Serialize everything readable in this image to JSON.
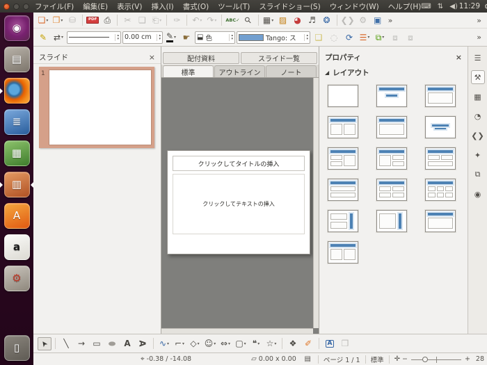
{
  "topbar": {
    "window_controls": [
      {
        "name": "close-button"
      },
      {
        "name": "minimize-button"
      },
      {
        "name": "maximize-button"
      }
    ],
    "menus": [
      {
        "name": "menu-file",
        "label": "ファイル(F)"
      },
      {
        "name": "menu-edit",
        "label": "編集(E)"
      },
      {
        "name": "menu-view",
        "label": "表示(V)"
      },
      {
        "name": "menu-insert",
        "label": "挿入(I)"
      },
      {
        "name": "menu-format",
        "label": "書式(O)"
      },
      {
        "name": "menu-tools",
        "label": "ツール(T)"
      },
      {
        "name": "menu-slideshow",
        "label": "スライドショー(S)"
      },
      {
        "name": "menu-window",
        "label": "ウィンドウ(W)"
      },
      {
        "name": "menu-help",
        "label": "ヘルプ(H)"
      }
    ],
    "tray": [
      {
        "name": "keyboard-indicator-icon",
        "glyph": "⌨"
      },
      {
        "name": "network-indicator-icon",
        "glyph": "⇅"
      },
      {
        "name": "volume-indicator-icon",
        "glyph": "◀)"
      }
    ],
    "clock": "11:29",
    "session_glyph": "⚙"
  },
  "launcher": {
    "items": [
      {
        "name": "launcher-ubuntu-dash",
        "kind": "ubuntu",
        "glyph": "◉"
      },
      {
        "name": "launcher-files",
        "kind": "files",
        "glyph": "▤"
      },
      {
        "name": "launcher-firefox",
        "kind": "firefox",
        "glyph": "",
        "pips": [
          "left"
        ]
      },
      {
        "name": "launcher-writer",
        "kind": "writer",
        "glyph": "≣"
      },
      {
        "name": "launcher-calc",
        "kind": "calc",
        "glyph": "▦"
      },
      {
        "name": "launcher-impress",
        "kind": "impress",
        "glyph": "▥",
        "pips": [
          "left",
          "right"
        ]
      },
      {
        "name": "launcher-software-center",
        "kind": "software",
        "glyph": "A"
      },
      {
        "name": "launcher-amazon",
        "kind": "amazon",
        "glyph": "a"
      },
      {
        "name": "launcher-settings",
        "kind": "settings",
        "glyph": "⚙"
      },
      {
        "name": "launcher-trash",
        "kind": "trash",
        "glyph": "▯",
        "pin": "bottom"
      }
    ]
  },
  "toolbar_main": {
    "items": [
      {
        "t": "b",
        "name": "new-presentation-button",
        "glyph": "❏",
        "cls": "c-impress",
        "dd": true
      },
      {
        "t": "b",
        "name": "open-button",
        "glyph": "❐",
        "cls": "c-folder",
        "dd": true
      },
      {
        "t": "b",
        "name": "save-button",
        "glyph": "⛁",
        "dim": true
      },
      {
        "t": "s"
      },
      {
        "t": "b",
        "name": "export-pdf-button",
        "glyph": "PDF",
        "cls": "i-pdf"
      },
      {
        "t": "b",
        "name": "print-button",
        "glyph": "⎙"
      },
      {
        "t": "s"
      },
      {
        "t": "b",
        "name": "cut-button",
        "glyph": "✂",
        "dim": true
      },
      {
        "t": "b",
        "name": "copy-button",
        "glyph": "❏",
        "dim": true
      },
      {
        "t": "b",
        "name": "paste-button",
        "glyph": "⎗",
        "dim": true,
        "dd": true
      },
      {
        "t": "s"
      },
      {
        "t": "b",
        "name": "clone-formatting-button",
        "glyph": "✑",
        "dim": true
      },
      {
        "t": "s"
      },
      {
        "t": "b",
        "name": "undo-button",
        "glyph": "↶",
        "dim": true,
        "dd": true
      },
      {
        "t": "b",
        "name": "redo-button",
        "glyph": "↷",
        "dim": true,
        "dd": true
      },
      {
        "t": "s"
      },
      {
        "t": "b",
        "name": "spelling-button",
        "glyph": "ABC✓",
        "cls": "i-spell"
      },
      {
        "t": "b",
        "name": "zoom-button",
        "glyph": "⚲",
        "cls": "i-zoom"
      },
      {
        "t": "s"
      },
      {
        "t": "b",
        "name": "insert-table-button",
        "glyph": "▦",
        "cls": "c-table",
        "dd": true
      },
      {
        "t": "b",
        "name": "insert-image-button",
        "glyph": "▨",
        "cls": "c-image"
      },
      {
        "t": "b",
        "name": "insert-chart-button",
        "glyph": "◕",
        "cls": "c-chart"
      },
      {
        "t": "b",
        "name": "insert-media-button",
        "glyph": "♬",
        "cls": "c-media"
      },
      {
        "t": "b",
        "name": "insert-hyperlink-button",
        "glyph": "❂",
        "cls": "c-blue"
      },
      {
        "t": "s"
      },
      {
        "t": "b",
        "name": "show-draw-functions-button",
        "glyph": "❮❯",
        "dim": true
      },
      {
        "t": "b",
        "name": "options-button",
        "glyph": "⚙",
        "dim": true
      },
      {
        "t": "b",
        "name": "presentation-button",
        "glyph": "▣",
        "cls": "c-screen"
      },
      {
        "t": "o",
        "name": "standard-toolbar-overflow"
      },
      {
        "t": "sp"
      },
      {
        "t": "o",
        "name": "presentation-toolbar-overflow"
      }
    ]
  },
  "toolbar_line": {
    "items": [
      {
        "t": "b",
        "name": "line-button",
        "glyph": "✎",
        "cls": "c-pen"
      },
      {
        "t": "b",
        "name": "arrow-style-button",
        "glyph": "⇄",
        "dd": true
      },
      {
        "t": "c",
        "name": "line-style-select",
        "kind": "line",
        "spin": true,
        "w": 78
      },
      {
        "t": "c",
        "name": "line-width-spinner",
        "value": "0.00 cm",
        "spin": true,
        "w": 58
      },
      {
        "t": "b",
        "name": "line-color-button",
        "glyph": "✎",
        "cls": "u-black",
        "dd": true
      },
      {
        "t": "b",
        "name": "area-dialog-button",
        "glyph": "☛",
        "cls": "c-hand"
      },
      {
        "t": "c",
        "name": "area-style-select",
        "glyph": "⬓",
        "value": "色",
        "spin": true,
        "w": 58
      },
      {
        "t": "c",
        "name": "fill-color-select",
        "kind": "swatch",
        "value": "Tango: ス",
        "spin": true,
        "w": 106
      },
      {
        "t": "b",
        "name": "shadow-button",
        "glyph": "❑",
        "cls": "c-shadow"
      },
      {
        "t": "b",
        "name": "transform-button",
        "glyph": "◌",
        "dim": true
      },
      {
        "t": "b",
        "name": "rotate-button",
        "glyph": "⟳",
        "cls": "c-rotate"
      },
      {
        "t": "b",
        "name": "align-button",
        "glyph": "☰",
        "cls": "c-align",
        "dd": true
      },
      {
        "t": "b",
        "name": "arrange-button",
        "glyph": "⧉",
        "cls": "c-green",
        "dd": true
      },
      {
        "t": "b",
        "name": "group-button",
        "glyph": "⧈",
        "dim": true
      },
      {
        "t": "b",
        "name": "enter-group-button",
        "glyph": "⧈",
        "dim": true
      },
      {
        "t": "sp"
      },
      {
        "t": "o",
        "name": "line-toolbar-overflow"
      }
    ]
  },
  "slides_panel": {
    "title": "スライド",
    "close_glyph": "×",
    "slides": [
      {
        "number": "1"
      }
    ]
  },
  "workspace": {
    "tabs_upper": [
      {
        "name": "tab-handout",
        "label": "配付資料"
      },
      {
        "name": "tab-slide-sorter",
        "label": "スライド一覧"
      }
    ],
    "tabs_lower": [
      {
        "name": "tab-normal",
        "label": "標準",
        "active": true
      },
      {
        "name": "tab-outline",
        "label": "アウトライン"
      },
      {
        "name": "tab-notes",
        "label": "ノート"
      }
    ],
    "slide": {
      "title_placeholder": "クリックしてタイトルの挿入",
      "text_placeholder": "クリックしてテキストの挿入"
    }
  },
  "properties_panel": {
    "title": "プロパティ",
    "close_glyph": "×",
    "collapse_glyph": "◢",
    "section_label": "レイアウト",
    "layouts": [
      {
        "id": "blank",
        "boxes": []
      },
      {
        "id": "title-subtitle",
        "boxes": [
          [
            8,
            10,
            84,
            14,
            "bar"
          ],
          [
            30,
            42,
            40,
            12,
            "bar"
          ]
        ]
      },
      {
        "id": "title-content",
        "boxes": [
          [
            8,
            10,
            84,
            14,
            "bar"
          ],
          [
            8,
            32,
            84,
            56,
            "box"
          ]
        ]
      },
      {
        "id": "title-two-content",
        "boxes": [
          [
            8,
            10,
            84,
            14,
            "bar"
          ],
          [
            8,
            32,
            40,
            56,
            "box"
          ],
          [
            52,
            32,
            40,
            56,
            "box"
          ]
        ]
      },
      {
        "id": "title-only",
        "boxes": [
          [
            8,
            10,
            84,
            14,
            "bar"
          ],
          [
            8,
            32,
            84,
            56,
            "box"
          ]
        ]
      },
      {
        "id": "centered-text",
        "boxes": [
          [
            22,
            38,
            56,
            10,
            "bar"
          ],
          [
            30,
            52,
            40,
            8,
            "bar"
          ]
        ]
      },
      {
        "id": "two-content-and-content",
        "boxes": [
          [
            8,
            10,
            84,
            14,
            "bar"
          ],
          [
            8,
            32,
            40,
            25,
            "box"
          ],
          [
            8,
            62,
            40,
            26,
            "box"
          ],
          [
            52,
            32,
            40,
            56,
            "box"
          ]
        ]
      },
      {
        "id": "content-and-two-content",
        "boxes": [
          [
            8,
            10,
            84,
            14,
            "bar"
          ],
          [
            8,
            32,
            40,
            56,
            "box"
          ],
          [
            52,
            32,
            40,
            25,
            "box"
          ],
          [
            52,
            62,
            40,
            26,
            "box"
          ]
        ]
      },
      {
        "id": "two-content-over-content",
        "boxes": [
          [
            8,
            10,
            84,
            14,
            "bar"
          ],
          [
            8,
            32,
            40,
            25,
            "box"
          ],
          [
            52,
            32,
            40,
            25,
            "box"
          ],
          [
            8,
            62,
            84,
            26,
            "box"
          ]
        ]
      },
      {
        "id": "content-over-content",
        "boxes": [
          [
            8,
            10,
            84,
            14,
            "bar"
          ],
          [
            8,
            32,
            84,
            25,
            "box"
          ],
          [
            8,
            62,
            84,
            26,
            "box"
          ]
        ]
      },
      {
        "id": "four-content",
        "boxes": [
          [
            8,
            10,
            84,
            14,
            "bar"
          ],
          [
            8,
            32,
            40,
            25,
            "box"
          ],
          [
            52,
            32,
            40,
            25,
            "box"
          ],
          [
            8,
            62,
            40,
            26,
            "box"
          ],
          [
            52,
            62,
            40,
            26,
            "box"
          ]
        ]
      },
      {
        "id": "six-content",
        "boxes": [
          [
            8,
            10,
            84,
            14,
            "bar"
          ],
          [
            8,
            32,
            25,
            25,
            "box"
          ],
          [
            37,
            32,
            25,
            25,
            "box"
          ],
          [
            66,
            32,
            26,
            25,
            "box"
          ],
          [
            8,
            62,
            25,
            26,
            "box"
          ],
          [
            37,
            62,
            25,
            26,
            "box"
          ],
          [
            66,
            62,
            26,
            26,
            "box"
          ]
        ]
      },
      {
        "id": "vertical-title-text-chart",
        "boxes": [
          [
            8,
            12,
            56,
            32,
            "box"
          ],
          [
            8,
            52,
            56,
            34,
            "box"
          ],
          [
            74,
            12,
            10,
            76,
            "vbar"
          ]
        ]
      },
      {
        "id": "vertical-title-vertical-text",
        "boxes": [
          [
            8,
            12,
            56,
            76,
            "box"
          ],
          [
            74,
            12,
            10,
            76,
            "vbar"
          ]
        ]
      },
      {
        "id": "title-vertical-text",
        "boxes": [
          [
            8,
            10,
            84,
            14,
            "bar"
          ],
          [
            8,
            32,
            84,
            56,
            "box"
          ]
        ]
      },
      {
        "id": "title-two-vertical-text",
        "boxes": [
          [
            8,
            10,
            84,
            14,
            "bar"
          ],
          [
            8,
            32,
            40,
            56,
            "box"
          ],
          [
            52,
            32,
            40,
            56,
            "box"
          ]
        ]
      }
    ]
  },
  "sidebar_tabs": {
    "items": [
      {
        "name": "sidebar-settings-button",
        "glyph": "☰"
      },
      {
        "name": "properties-tab",
        "glyph": "⚒",
        "active": true
      },
      {
        "name": "master-pages-tab",
        "glyph": "▦",
        "cls": "c-screen2"
      },
      {
        "name": "slide-transition-tab",
        "glyph": "◔"
      },
      {
        "name": "custom-animation-tab",
        "glyph": "❮❯",
        "cls": "c-blue2"
      },
      {
        "name": "gallery-tab",
        "glyph": "✦",
        "cls": "c-orange2"
      },
      {
        "name": "styles-tab",
        "glyph": "⧉"
      },
      {
        "name": "navigator-tab",
        "glyph": "◉",
        "cls": "c-blue2"
      }
    ]
  },
  "toolbar_drawing": {
    "items": [
      {
        "t": "b",
        "name": "select-tool",
        "glyph": "➤",
        "cls": "i-cursor",
        "active": true
      },
      {
        "t": "s"
      },
      {
        "t": "b",
        "name": "line-tool",
        "glyph": "╲"
      },
      {
        "t": "b",
        "name": "arrow-tool",
        "glyph": "→"
      },
      {
        "t": "b",
        "name": "rectangle-tool",
        "glyph": "▭"
      },
      {
        "t": "b",
        "name": "ellipse-tool",
        "glyph": "●",
        "cls": "i-oval"
      },
      {
        "t": "b",
        "name": "textbox-tool",
        "glyph": "A",
        "cls": "i-text"
      },
      {
        "t": "b",
        "name": "vertical-text-tool",
        "glyph": "A",
        "cls": "i-vtext"
      },
      {
        "t": "s"
      },
      {
        "t": "b",
        "name": "curve-tool",
        "glyph": "∿",
        "cls": "c-blue",
        "dd": true
      },
      {
        "t": "b",
        "name": "connector-tool",
        "glyph": "⌐",
        "cls": "c-conn",
        "dd": true
      },
      {
        "t": "b",
        "name": "basic-shapes-tool",
        "glyph": "◇",
        "dd": true
      },
      {
        "t": "b",
        "name": "symbol-shapes-tool",
        "glyph": "☺",
        "dd": true
      },
      {
        "t": "b",
        "name": "block-arrows-tool",
        "glyph": "⇔",
        "dd": true
      },
      {
        "t": "b",
        "name": "flowchart-tool",
        "glyph": "▢",
        "dd": true
      },
      {
        "t": "b",
        "name": "callouts-tool",
        "glyph": "❝",
        "dd": true
      },
      {
        "t": "b",
        "name": "stars-tool",
        "glyph": "☆",
        "dd": true
      },
      {
        "t": "s"
      },
      {
        "t": "b",
        "name": "edit-points-button",
        "glyph": "❖"
      },
      {
        "t": "b",
        "name": "glue-points-button",
        "glyph": "✐",
        "cls": "c-orange"
      },
      {
        "t": "s"
      },
      {
        "t": "b",
        "name": "fontwork-button",
        "glyph": "A",
        "cls": "i-fontwork"
      },
      {
        "t": "b",
        "name": "extrusion-button",
        "glyph": "❒",
        "dim": true
      }
    ]
  },
  "statusbar": {
    "position_icon": "⌖",
    "position": "-0.38 / -14.08",
    "size_icon": "▱",
    "size": "0.00 x 0.00",
    "doc_icon": "▤",
    "page": "ページ 1 / 1",
    "master": "標準",
    "fit_icon": "✛",
    "zoom_out": "−",
    "zoom_in": "+",
    "zoom_value": "28"
  }
}
